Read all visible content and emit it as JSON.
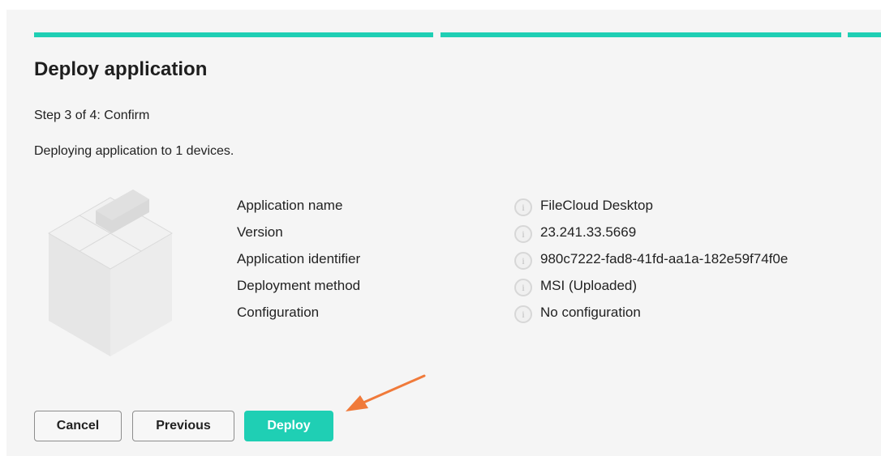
{
  "steps": 3,
  "title": "Deploy application",
  "subtitle": "Step 3 of 4: Confirm",
  "description": "Deploying application to 1 devices.",
  "details": [
    {
      "label": "Application name",
      "value": "FileCloud Desktop"
    },
    {
      "label": "Version",
      "value": "23.241.33.5669"
    },
    {
      "label": "Application identifier",
      "value": "980c7222-fad8-41fd-aa1a-182e59f74f0e"
    },
    {
      "label": "Deployment method",
      "value": "MSI (Uploaded)"
    },
    {
      "label": "Configuration",
      "value": "No configuration"
    }
  ],
  "info_icon": "i",
  "buttons": {
    "cancel": "Cancel",
    "previous": "Previous",
    "deploy": "Deploy"
  },
  "colors": {
    "accent": "#1fcfb4",
    "arrow": "#f07a3a",
    "panel": "#f5f5f5"
  }
}
